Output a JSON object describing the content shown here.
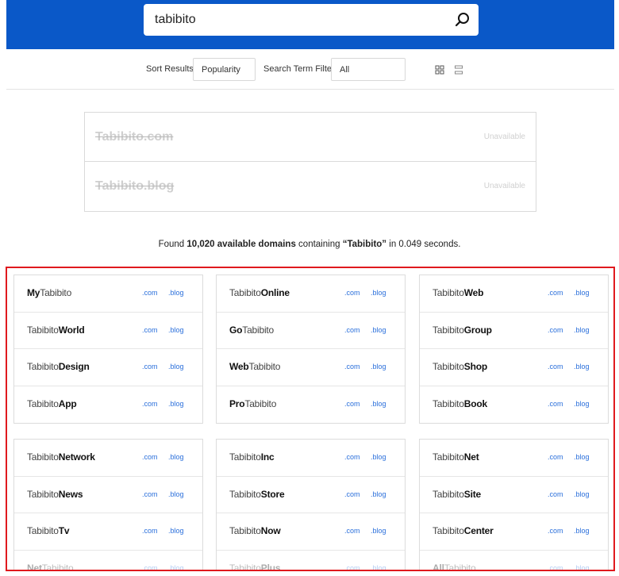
{
  "search": {
    "value": "tabibito"
  },
  "filters": {
    "sort_label": "Sort Results",
    "sort_value": "Popularity",
    "term_label": "Search Term Filter",
    "term_value": "All"
  },
  "featured": [
    {
      "name": "Tabibito.com",
      "status": "Unavailable"
    },
    {
      "name": "Tabibito.blog",
      "status": "Unavailable"
    }
  ],
  "summary": {
    "prefix": "Found ",
    "count": "10,020 available domains",
    "middle": " containing ",
    "term": "“Tabibito”",
    "suffix": " in 0.049 seconds."
  },
  "tlds": {
    "com": ".com",
    "blog": ".blog"
  },
  "groups": [
    [
      [
        {
          "light": "",
          "bold": "My"
        },
        {
          "light": "Tabibito",
          "bold": ""
        }
      ],
      [
        {
          "light": "Tabibito",
          "bold": ""
        },
        {
          "light": "",
          "bold": "World"
        }
      ],
      [
        {
          "light": "Tabibito",
          "bold": ""
        },
        {
          "light": "",
          "bold": "Design"
        }
      ],
      [
        {
          "light": "Tabibito",
          "bold": ""
        },
        {
          "light": "",
          "bold": "App"
        }
      ]
    ],
    [
      [
        {
          "light": "Tabibito",
          "bold": ""
        },
        {
          "light": "",
          "bold": "Online"
        }
      ],
      [
        {
          "light": "",
          "bold": "Go"
        },
        {
          "light": "Tabibito",
          "bold": ""
        }
      ],
      [
        {
          "light": "",
          "bold": "Web"
        },
        {
          "light": "Tabibito",
          "bold": ""
        }
      ],
      [
        {
          "light": "",
          "bold": "Pro"
        },
        {
          "light": "Tabibito",
          "bold": ""
        }
      ]
    ],
    [
      [
        {
          "light": "Tabibito",
          "bold": ""
        },
        {
          "light": "",
          "bold": "Web"
        }
      ],
      [
        {
          "light": "Tabibito",
          "bold": ""
        },
        {
          "light": "",
          "bold": "Group"
        }
      ],
      [
        {
          "light": "Tabibito",
          "bold": ""
        },
        {
          "light": "",
          "bold": "Shop"
        }
      ],
      [
        {
          "light": "Tabibito",
          "bold": ""
        },
        {
          "light": "",
          "bold": "Book"
        }
      ]
    ],
    [
      [
        {
          "light": "Tabibito",
          "bold": ""
        },
        {
          "light": "",
          "bold": "Network"
        }
      ],
      [
        {
          "light": "Tabibito",
          "bold": ""
        },
        {
          "light": "",
          "bold": "News"
        }
      ],
      [
        {
          "light": "Tabibito",
          "bold": ""
        },
        {
          "light": "",
          "bold": "Tv"
        }
      ],
      [
        {
          "light": "",
          "bold": "Net"
        },
        {
          "light": "Tabibito",
          "bold": ""
        }
      ]
    ],
    [
      [
        {
          "light": "Tabibito",
          "bold": ""
        },
        {
          "light": "",
          "bold": "Inc"
        }
      ],
      [
        {
          "light": "Tabibito",
          "bold": ""
        },
        {
          "light": "",
          "bold": "Store"
        }
      ],
      [
        {
          "light": "Tabibito",
          "bold": ""
        },
        {
          "light": "",
          "bold": "Now"
        }
      ],
      [
        {
          "light": "Tabibito",
          "bold": ""
        },
        {
          "light": "",
          "bold": "Plus"
        }
      ]
    ],
    [
      [
        {
          "light": "Tabibito",
          "bold": ""
        },
        {
          "light": "",
          "bold": "Net"
        }
      ],
      [
        {
          "light": "Tabibito",
          "bold": ""
        },
        {
          "light": "",
          "bold": "Site"
        }
      ],
      [
        {
          "light": "Tabibito",
          "bold": ""
        },
        {
          "light": "",
          "bold": "Center"
        }
      ],
      [
        {
          "light": "",
          "bold": "All"
        },
        {
          "light": "Tabibito",
          "bold": ""
        }
      ]
    ]
  ],
  "colors": {
    "header": "#0a58c8",
    "link": "#2a6fdb",
    "highlight_border": "#e0191e"
  },
  "icons": {
    "search": "search-icon",
    "grid_view": "grid-view-icon",
    "list_view": "list-view-icon"
  }
}
